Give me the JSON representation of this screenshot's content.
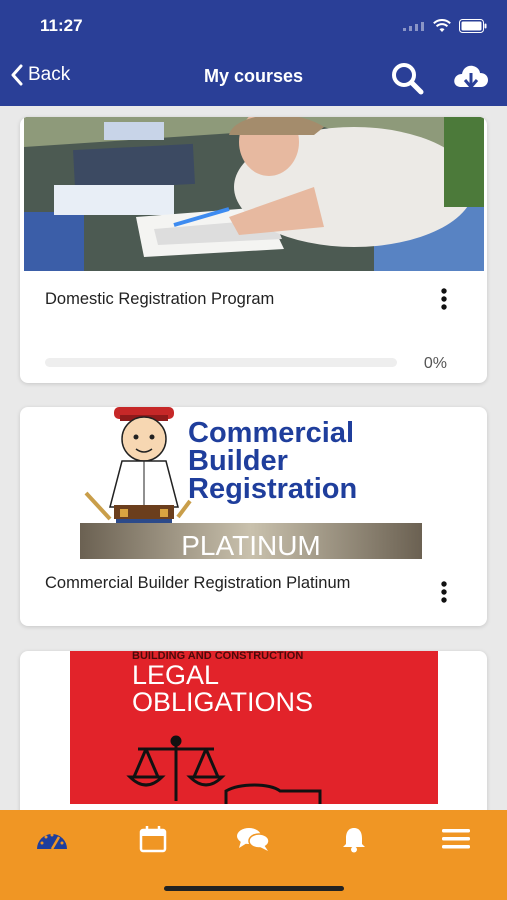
{
  "status_bar": {
    "time": "11:27"
  },
  "nav": {
    "back_label": "Back",
    "title": "My courses"
  },
  "courses": [
    {
      "title": "Domestic Registration Program",
      "progress_percent": 0,
      "progress_label": "0%"
    },
    {
      "title": "Commercial Builder Registration Platinum",
      "thumbnail_text": {
        "line1": "Commercial",
        "line2": "Builder",
        "line3": "Registration",
        "banner": "PLATINUM"
      }
    },
    {
      "title": "",
      "thumbnail_text": {
        "top": "BUILDING AND CONSTRUCTION",
        "line1": "LEGAL",
        "line2": "OBLIGATIONS"
      }
    }
  ],
  "tabbar": {
    "items": [
      "dashboard",
      "calendar",
      "messages",
      "notifications",
      "menu"
    ]
  },
  "colors": {
    "header": "#2a3f97",
    "tabbar": "#f09624",
    "red_cover": "#e2232a",
    "brand_blue": "#1f3e9c"
  }
}
